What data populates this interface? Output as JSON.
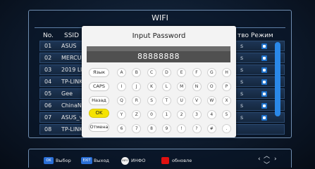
{
  "window": {
    "title": "WIFI"
  },
  "list": {
    "headers": {
      "no": "No.",
      "ssid": "SSID",
      "enc": "тво",
      "mode": "Режим"
    },
    "rows": [
      {
        "num": "01",
        "ssid": "ASUS",
        "enc": "s"
      },
      {
        "num": "02",
        "ssid": "MERCUR",
        "enc": "s"
      },
      {
        "num": "03",
        "ssid": "2019 LU",
        "enc": "s"
      },
      {
        "num": "04",
        "ssid": "TP-LINK",
        "enc": "s"
      },
      {
        "num": "05",
        "ssid": "Gee",
        "enc": "s"
      },
      {
        "num": "06",
        "ssid": "ChinaNe",
        "enc": "s"
      },
      {
        "num": "07",
        "ssid": "ASUS_vi",
        "enc": "s"
      },
      {
        "num": "08",
        "ssid": "TP-LINK",
        "enc": "s"
      }
    ]
  },
  "dialog": {
    "title": "Input Password",
    "password": "88888888",
    "function_keys": [
      "Язык",
      "CAPS",
      "Назад",
      "OK",
      "Отмена"
    ],
    "keys": [
      [
        "A",
        "B",
        "C",
        "D",
        "E",
        "F",
        "G",
        "H"
      ],
      [
        "I",
        "J",
        "K",
        "L",
        "M",
        "N",
        "O",
        "P"
      ],
      [
        "Q",
        "R",
        "S",
        "T",
        "U",
        "V",
        "W",
        "X"
      ],
      [
        "Y",
        "Z",
        "0",
        "1",
        "2",
        "3",
        "4",
        "5"
      ],
      [
        "6",
        "7",
        "8",
        "9",
        "!",
        "?",
        "#",
        "."
      ]
    ]
  },
  "footer": {
    "ok_key": "OK",
    "ok_label": "Выбор",
    "exit_key": "EXIT",
    "exit_label": "Выход",
    "info_key": "INFO",
    "info_label": "ИНФО",
    "red_label": "обновле"
  },
  "colors": {
    "ok_highlight": "#f5e300",
    "red_button": "#e01010",
    "scrollbar": "#2a88e8"
  }
}
